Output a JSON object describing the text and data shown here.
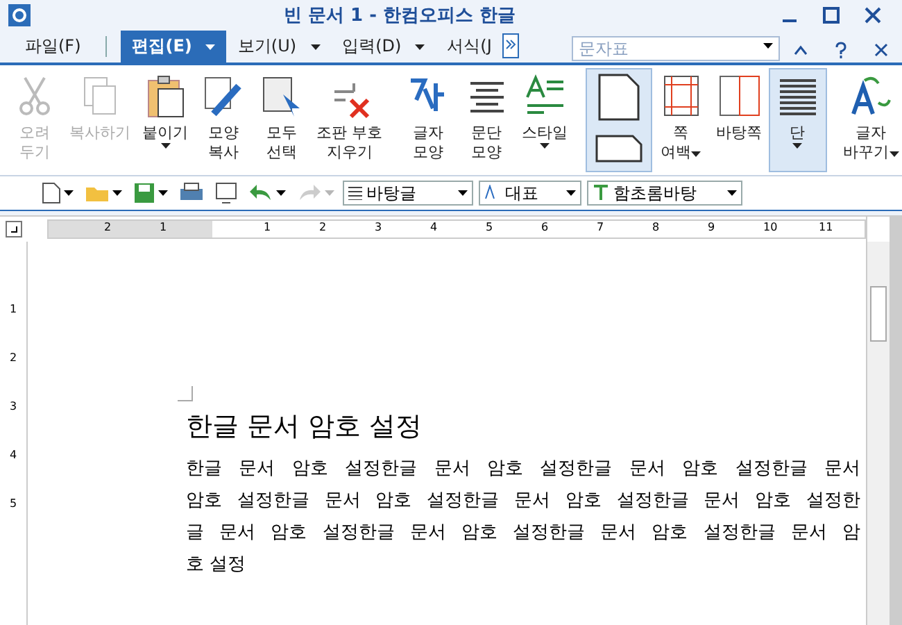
{
  "window": {
    "title": "빈 문서 1 - 한컴오피스 한글"
  },
  "menu": [
    {
      "label": "파일(F)",
      "selected": false,
      "dropdown": false
    },
    {
      "label": "편집(E)",
      "selected": true,
      "dropdown": true
    },
    {
      "label": "보기(U)",
      "selected": false,
      "dropdown": true
    },
    {
      "label": "입력(D)",
      "selected": false,
      "dropdown": true
    },
    {
      "label": "서식(J",
      "selected": false,
      "dropdown": false
    }
  ],
  "search": {
    "placeholder": "문자표"
  },
  "ribbon": [
    {
      "items": [
        {
          "kind": "scissors",
          "lines": [
            "오려",
            "두기"
          ],
          "disabled": true,
          "dropdown": false,
          "selected": false
        },
        {
          "kind": "copy",
          "lines": [
            "복사하기"
          ],
          "disabled": true,
          "dropdown": false,
          "selected": false
        },
        {
          "kind": "paste",
          "lines": [
            "붙이기"
          ],
          "disabled": false,
          "dropdown": true,
          "selected": false
        },
        {
          "kind": "brush",
          "lines": [
            "모양",
            "복사"
          ],
          "disabled": false,
          "dropdown": false,
          "selected": false
        },
        {
          "kind": "select",
          "lines": [
            "모두",
            "선택"
          ],
          "disabled": false,
          "dropdown": false,
          "selected": false
        },
        {
          "kind": "erase",
          "lines": [
            "조판 부호",
            "지우기"
          ],
          "disabled": false,
          "dropdown": false,
          "selected": false
        }
      ]
    },
    {
      "items": [
        {
          "kind": "charshape",
          "lines": [
            "글자",
            "모양"
          ],
          "disabled": false,
          "dropdown": false,
          "selected": false
        },
        {
          "kind": "para",
          "lines": [
            "문단",
            "모양"
          ],
          "disabled": false,
          "dropdown": false,
          "selected": false
        },
        {
          "kind": "style",
          "lines": [
            "스타일"
          ],
          "disabled": false,
          "dropdown": true,
          "selected": false
        }
      ]
    },
    {
      "items": [
        {
          "kind": "orient",
          "disabled": false,
          "dropdown": false,
          "selected": true
        },
        {
          "kind": "margin",
          "lines": [
            "쪽",
            "여백"
          ],
          "disabled": false,
          "dropdown": true,
          "selected": false
        },
        {
          "kind": "master",
          "lines": [
            "바탕쪽"
          ],
          "disabled": false,
          "dropdown": false,
          "selected": false
        },
        {
          "kind": "columns",
          "lines": [
            "단"
          ],
          "disabled": false,
          "dropdown": true,
          "selected": true
        }
      ]
    },
    {
      "items": [
        {
          "kind": "replace",
          "lines": [
            "글자",
            "바꾸기"
          ],
          "disabled": false,
          "dropdown": true,
          "selected": false
        }
      ]
    }
  ],
  "toolbar": {
    "style": "바탕글",
    "language": "대표",
    "font": "함초롬바탕"
  },
  "ruler": {
    "labels": [
      "2",
      "1",
      "1",
      "2",
      "3",
      "4",
      "5",
      "6",
      "7",
      "8",
      "9",
      "10",
      "11"
    ]
  },
  "vruler": {
    "labels": [
      "1",
      "2",
      "3",
      "4",
      "5"
    ]
  },
  "document": {
    "heading": "한글 문서 암호 설정",
    "lines": [
      "한글 문서 암호 설정한글 문서 암호 설정한글 문서 암호 설정한글 문서",
      "암호 설정한글 문서 암호 설정한글 문서 암호 설정한글 문서 암호 설정한",
      "글 문서 암호 설정한글 문서 암호 설정한글 문서 암호 설정한글 문서 암",
      "호 설정"
    ]
  }
}
